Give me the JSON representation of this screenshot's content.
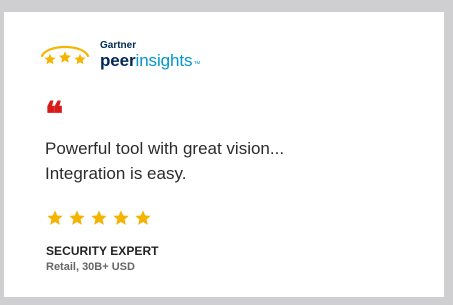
{
  "logo": {
    "company": "Gartner",
    "brand_primary": "peer",
    "brand_secondary": "insights",
    "brand_suffix": "™",
    "icon": "three-stars-logo-icon",
    "colors": {
      "navy": "#002856",
      "teal": "#0096c7",
      "gold": "#f4b400"
    }
  },
  "review": {
    "quote_mark": "❝",
    "text": "Powerful tool with great vision...\nIntegration is easy.",
    "rating": 5,
    "rating_max": 5,
    "reviewer_role": "SECURITY EXPERT",
    "reviewer_org": "Retail, 30B+ USD"
  },
  "colors": {
    "background": "#cfcfd1",
    "card": "#ffffff",
    "accent_red": "#d91a1a",
    "star_gold": "#f4b400"
  }
}
